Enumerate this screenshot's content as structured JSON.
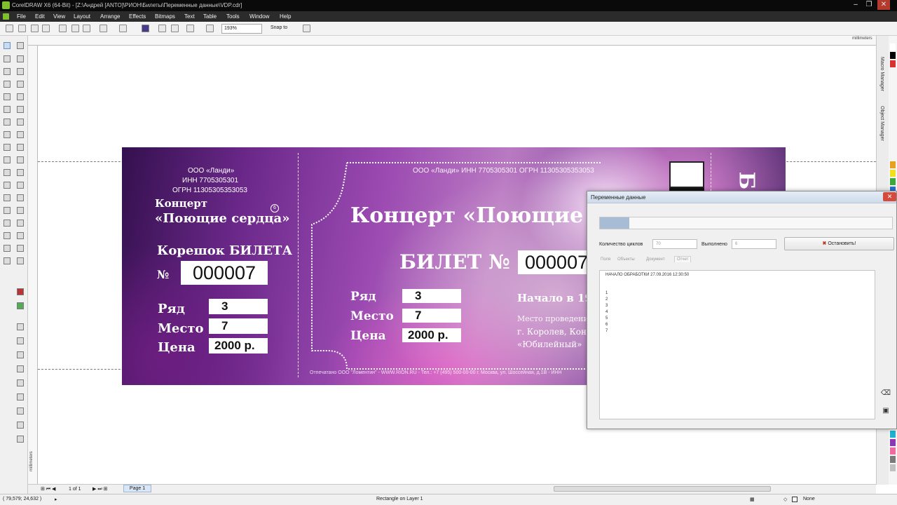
{
  "window": {
    "title": "CorelDRAW X6 (64-Bit) - [Z:\\Андрей [ANTO]\\РИОН\\Билеты\\Переменные данные\\VDP.cdr]",
    "minimize": "–",
    "restore": "❐",
    "close": "✕"
  },
  "menu": [
    "File",
    "Edit",
    "View",
    "Layout",
    "Arrange",
    "Effects",
    "Bitmaps",
    "Text",
    "Table",
    "Tools",
    "Window",
    "Help"
  ],
  "toolbar": {
    "zoom": "193%",
    "snap_to": "Snap to"
  },
  "rulers": {
    "unit": "millimeters"
  },
  "dockers": [
    "Macro Manager",
    "Object Manager"
  ],
  "palette_colors": [
    "#ffffff",
    "#000000",
    "#d93030",
    "#e8a020",
    "#f0e020",
    "#3aa83a",
    "#2a70c8",
    "#20b0d0",
    "#8a3ab0",
    "#f06aa0",
    "#7a7a7a",
    "#c0c0c0"
  ],
  "ticket": {
    "stub": {
      "org": "ООО «Ланди»",
      "inn": "ИНН 7705305301",
      "ogrn": "ОГРН 11305305353053",
      "concert": "Концерт",
      "show_name": "«Поющие сердца»",
      "rating": "6",
      "heading": "Корешок БИЛЕТА",
      "number_sign": "№",
      "number": "000007",
      "row_label": "Ряд",
      "row_value": "3",
      "seat_label": "Место",
      "seat_value": "7",
      "price_label": "Цена",
      "price_value": "2000 р."
    },
    "main": {
      "header": "ООО «Ланди»  ИНН 7705305301  ОГРН 11305305353053",
      "title": "Концерт «Поющие серд",
      "ticket_label": "БИЛЕТ №",
      "number": "000007",
      "row_label": "Ряд",
      "row_value": "3",
      "seat_label": "Место",
      "seat_value": "7",
      "price_label": "Цена",
      "price_value": "2000 р.",
      "start": "Начало в 19",
      "venue_label": "Место проведения:",
      "venue_line1": "г. Королев, Кон",
      "venue_line2": "«Юбилейный»",
      "footer": "Отпечатано ООО \"Ломентин\" - WWW.RION.RU - Тел.: +7 (495) 500-00-00 г. Москва, ул. Шоссейная, д.1В - ИНН"
    },
    "right_letter": "Б"
  },
  "dialog": {
    "title": "Переменные данные",
    "progress": 0.1,
    "cycles_label": "Количество циклов",
    "cycles_value": "70",
    "done_label": "Выполнено",
    "done_value": "6",
    "stop_button": "Остановить!",
    "tabs": [
      "Поля",
      "Объекты",
      "Документ",
      "Отчет"
    ],
    "log": [
      "НАЧАЛО ОБРАБОТКИ 27.09.2016 12:30:50",
      "",
      "1",
      "2",
      "3",
      "4",
      "5",
      "6",
      "7"
    ]
  },
  "pagebar": {
    "page_count": "1 of 1",
    "page_tab": "Page 1"
  },
  "status": {
    "coordinates": "( 79,579; 24,632 )",
    "selection": "Rectangle on Layer 1",
    "fill": "None"
  }
}
